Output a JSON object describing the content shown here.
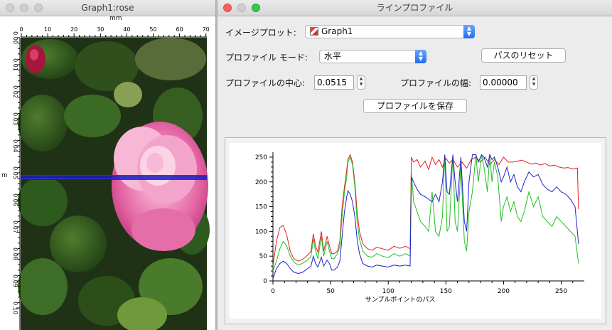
{
  "graph_window": {
    "title": "Graph1:rose",
    "x_axis_unit": "mm",
    "y_axis_unit": "m",
    "x_ticks": [
      "0",
      "10",
      "20",
      "30",
      "40",
      "50",
      "60",
      "70"
    ],
    "y_ticks": [
      "0.00",
      "0.01",
      "0.02",
      "0.03",
      "0.04",
      "0.05",
      "0.06",
      "0.07",
      "0.08",
      "0.09",
      "0.10"
    ]
  },
  "profile_window": {
    "title": "ラインプロファイル",
    "image_plot_label": "イメージプロット:",
    "image_plot_value": "Graph1",
    "profile_mode_label": "プロファイル モード:",
    "profile_mode_value": "水平",
    "reset_path_button": "パスのリセット",
    "center_label": "プロファイルの中心:",
    "center_value": "0.0515",
    "width_label": "プロファイルの幅:",
    "width_value": "0.00000",
    "save_button": "プロファイルを保存"
  },
  "chart_data": {
    "type": "line",
    "xlabel": "サンプルポイントのパス",
    "ylabel": "",
    "xlim": [
      0,
      270
    ],
    "ylim": [
      0,
      260
    ],
    "x_ticks": [
      0,
      50,
      100,
      150,
      200,
      250
    ],
    "y_ticks": [
      0,
      50,
      100,
      150,
      200,
      250
    ],
    "grid": false,
    "series": [
      {
        "color": "#e02020",
        "points": [
          [
            0,
            30
          ],
          [
            3,
            80
          ],
          [
            6,
            108
          ],
          [
            9,
            112
          ],
          [
            12,
            92
          ],
          [
            15,
            60
          ],
          [
            18,
            45
          ],
          [
            22,
            40
          ],
          [
            26,
            44
          ],
          [
            30,
            52
          ],
          [
            33,
            60
          ],
          [
            35,
            95
          ],
          [
            37,
            70
          ],
          [
            39,
            58
          ],
          [
            42,
            100
          ],
          [
            44,
            60
          ],
          [
            47,
            90
          ],
          [
            49,
            70
          ],
          [
            51,
            55
          ],
          [
            53,
            55
          ],
          [
            56,
            60
          ],
          [
            58,
            80
          ],
          [
            60,
            150
          ],
          [
            62,
            190
          ],
          [
            64,
            225
          ],
          [
            65,
            245
          ],
          [
            67,
            255
          ],
          [
            69,
            240
          ],
          [
            71,
            200
          ],
          [
            73,
            140
          ],
          [
            75,
            100
          ],
          [
            78,
            75
          ],
          [
            82,
            65
          ],
          [
            86,
            62
          ],
          [
            90,
            68
          ],
          [
            95,
            65
          ],
          [
            100,
            62
          ],
          [
            105,
            70
          ],
          [
            110,
            66
          ],
          [
            115,
            70
          ],
          [
            119,
            65
          ],
          [
            120,
            250
          ],
          [
            122,
            240
          ],
          [
            125,
            245
          ],
          [
            128,
            230
          ],
          [
            132,
            242
          ],
          [
            135,
            225
          ],
          [
            138,
            250
          ],
          [
            141,
            235
          ],
          [
            144,
            245
          ],
          [
            147,
            230
          ],
          [
            150,
            248
          ],
          [
            153,
            238
          ],
          [
            156,
            245
          ],
          [
            160,
            230
          ],
          [
            164,
            240
          ],
          [
            168,
            228
          ],
          [
            172,
            245
          ],
          [
            176,
            250
          ],
          [
            180,
            240
          ],
          [
            184,
            250
          ],
          [
            188,
            235
          ],
          [
            192,
            245
          ],
          [
            196,
            235
          ],
          [
            200,
            250
          ],
          [
            204,
            240
          ],
          [
            208,
            240
          ],
          [
            212,
            242
          ],
          [
            216,
            244
          ],
          [
            220,
            240
          ],
          [
            224,
            236
          ],
          [
            228,
            238
          ],
          [
            232,
            234
          ],
          [
            236,
            237
          ],
          [
            240,
            232
          ],
          [
            244,
            234
          ],
          [
            248,
            230
          ],
          [
            252,
            228
          ],
          [
            256,
            229
          ],
          [
            260,
            226
          ],
          [
            264,
            228
          ],
          [
            265,
            145
          ]
        ]
      },
      {
        "color": "#20c020",
        "points": [
          [
            0,
            20
          ],
          [
            3,
            40
          ],
          [
            6,
            65
          ],
          [
            9,
            80
          ],
          [
            12,
            70
          ],
          [
            15,
            50
          ],
          [
            18,
            38
          ],
          [
            22,
            32
          ],
          [
            26,
            36
          ],
          [
            30,
            42
          ],
          [
            33,
            50
          ],
          [
            35,
            85
          ],
          [
            37,
            60
          ],
          [
            39,
            45
          ],
          [
            42,
            90
          ],
          [
            44,
            50
          ],
          [
            47,
            80
          ],
          [
            49,
            60
          ],
          [
            51,
            45
          ],
          [
            53,
            45
          ],
          [
            56,
            55
          ],
          [
            58,
            70
          ],
          [
            60,
            130
          ],
          [
            62,
            180
          ],
          [
            64,
            210
          ],
          [
            65,
            240
          ],
          [
            67,
            250
          ],
          [
            69,
            235
          ],
          [
            71,
            190
          ],
          [
            73,
            120
          ],
          [
            75,
            85
          ],
          [
            78,
            60
          ],
          [
            82,
            50
          ],
          [
            86,
            48
          ],
          [
            90,
            55
          ],
          [
            95,
            50
          ],
          [
            100,
            47
          ],
          [
            105,
            55
          ],
          [
            110,
            50
          ],
          [
            115,
            55
          ],
          [
            119,
            50
          ],
          [
            120,
            220
          ],
          [
            122,
            160
          ],
          [
            125,
            140
          ],
          [
            128,
            120
          ],
          [
            132,
            110
          ],
          [
            135,
            100
          ],
          [
            138,
            180
          ],
          [
            141,
            100
          ],
          [
            144,
            90
          ],
          [
            147,
            130
          ],
          [
            149,
            255
          ],
          [
            151,
            100
          ],
          [
            153,
            110
          ],
          [
            156,
            255
          ],
          [
            158,
            120
          ],
          [
            160,
            100
          ],
          [
            163,
            230
          ],
          [
            166,
            80
          ],
          [
            168,
            60
          ],
          [
            170,
            140
          ],
          [
            173,
            180
          ],
          [
            176,
            255
          ],
          [
            178,
            200
          ],
          [
            181,
            255
          ],
          [
            183,
            230
          ],
          [
            186,
            180
          ],
          [
            188,
            255
          ],
          [
            190,
            200
          ],
          [
            192,
            240
          ],
          [
            195,
            210
          ],
          [
            198,
            120
          ],
          [
            200,
            150
          ],
          [
            203,
            170
          ],
          [
            206,
            140
          ],
          [
            209,
            160
          ],
          [
            212,
            130
          ],
          [
            215,
            120
          ],
          [
            218,
            140
          ],
          [
            222,
            180
          ],
          [
            226,
            150
          ],
          [
            230,
            170
          ],
          [
            234,
            130
          ],
          [
            238,
            120
          ],
          [
            242,
            110
          ],
          [
            246,
            130
          ],
          [
            250,
            120
          ],
          [
            254,
            110
          ],
          [
            258,
            100
          ],
          [
            262,
            90
          ],
          [
            265,
            35
          ]
        ]
      },
      {
        "color": "#2020d0",
        "points": [
          [
            0,
            5
          ],
          [
            3,
            25
          ],
          [
            6,
            35
          ],
          [
            9,
            40
          ],
          [
            12,
            35
          ],
          [
            15,
            25
          ],
          [
            18,
            18
          ],
          [
            22,
            15
          ],
          [
            26,
            18
          ],
          [
            30,
            25
          ],
          [
            33,
            30
          ],
          [
            35,
            50
          ],
          [
            37,
            35
          ],
          [
            39,
            28
          ],
          [
            42,
            48
          ],
          [
            44,
            30
          ],
          [
            47,
            42
          ],
          [
            49,
            35
          ],
          [
            51,
            22
          ],
          [
            53,
            22
          ],
          [
            56,
            28
          ],
          [
            58,
            40
          ],
          [
            60,
            90
          ],
          [
            62,
            140
          ],
          [
            64,
            170
          ],
          [
            65,
            182
          ],
          [
            67,
            175
          ],
          [
            69,
            160
          ],
          [
            71,
            130
          ],
          [
            73,
            85
          ],
          [
            75,
            55
          ],
          [
            78,
            35
          ],
          [
            82,
            30
          ],
          [
            86,
            28
          ],
          [
            90,
            32
          ],
          [
            95,
            30
          ],
          [
            100,
            28
          ],
          [
            105,
            32
          ],
          [
            110,
            30
          ],
          [
            115,
            32
          ],
          [
            119,
            30
          ],
          [
            120,
            210
          ],
          [
            122,
            200
          ],
          [
            125,
            185
          ],
          [
            128,
            175
          ],
          [
            132,
            170
          ],
          [
            135,
            165
          ],
          [
            138,
            160
          ],
          [
            141,
            175
          ],
          [
            144,
            160
          ],
          [
            147,
            200
          ],
          [
            149,
            255
          ],
          [
            151,
            180
          ],
          [
            153,
            175
          ],
          [
            156,
            255
          ],
          [
            158,
            200
          ],
          [
            160,
            160
          ],
          [
            163,
            250
          ],
          [
            166,
            120
          ],
          [
            168,
            100
          ],
          [
            170,
            200
          ],
          [
            173,
            255
          ],
          [
            176,
            255
          ],
          [
            178,
            240
          ],
          [
            181,
            255
          ],
          [
            183,
            250
          ],
          [
            186,
            230
          ],
          [
            188,
            255
          ],
          [
            190,
            245
          ],
          [
            192,
            250
          ],
          [
            195,
            230
          ],
          [
            198,
            200
          ],
          [
            200,
            210
          ],
          [
            203,
            230
          ],
          [
            206,
            200
          ],
          [
            209,
            215
          ],
          [
            212,
            190
          ],
          [
            215,
            180
          ],
          [
            218,
            200
          ],
          [
            222,
            220
          ],
          [
            226,
            210
          ],
          [
            230,
            215
          ],
          [
            234,
            195
          ],
          [
            238,
            185
          ],
          [
            242,
            180
          ],
          [
            246,
            190
          ],
          [
            250,
            180
          ],
          [
            254,
            175
          ],
          [
            258,
            165
          ],
          [
            262,
            150
          ],
          [
            265,
            75
          ]
        ]
      }
    ]
  }
}
